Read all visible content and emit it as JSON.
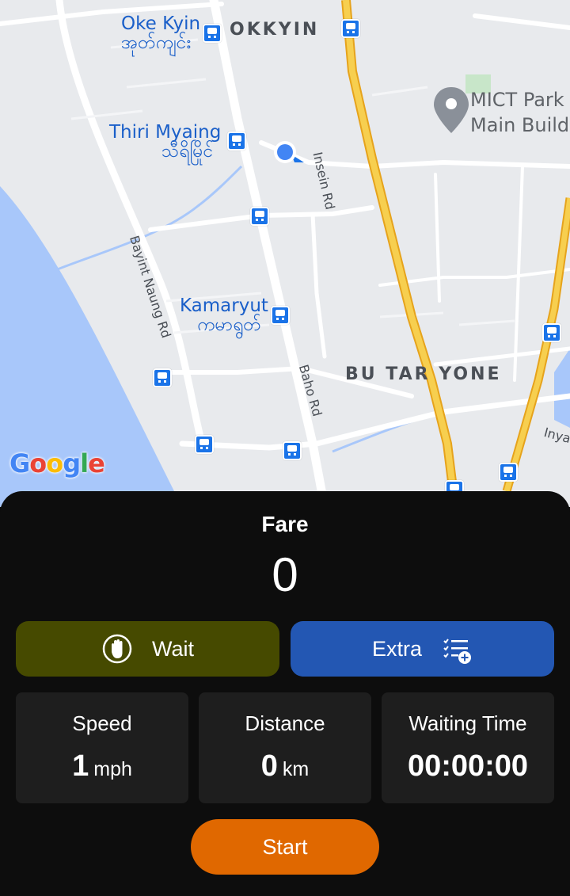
{
  "map": {
    "areas": {
      "okkyin": "OKKYIN",
      "bu_tar_yone": "BU TAR YONE"
    },
    "places": {
      "oke_kyin_en": "Oke Kyin",
      "oke_kyin_my": "အုတ်ကျင်း",
      "thiri_myaing_en": "Thiri Myaing",
      "thiri_myaing_my": "သီရိမြိုင်",
      "kamaryut_en": "Kamaryut",
      "kamaryut_my": "ကမာရွတ်"
    },
    "poi": {
      "line1": "MICT Park",
      "line2": "Main Build"
    },
    "roads": {
      "insein": "Insein Rd",
      "bayint_naung": "Bayint Naung Rd",
      "baho": "Baho Rd",
      "inya": "Inya"
    },
    "logo": "Google",
    "colors": {
      "background": "#e8eaed",
      "river": "#a8c7fa",
      "highway": "#f5c242",
      "location": "#4285f4"
    }
  },
  "panel": {
    "fare_title": "Fare",
    "fare_value": "0",
    "wait_label": "Wait",
    "wait_icon": "hand-stop-icon",
    "extra_label": "Extra",
    "extra_icon": "checklist-add-icon",
    "stats": {
      "speed_label": "Speed",
      "speed_value": "1",
      "speed_unit": "mph",
      "distance_label": "Distance",
      "distance_value": "0",
      "distance_unit": "km",
      "waiting_label": "Waiting Time",
      "waiting_value": "00:00:00"
    },
    "start_label": "Start",
    "colors": {
      "wait": "#464a00",
      "extra": "#2357b3",
      "start": "#e06800",
      "card": "#1e1e1e"
    }
  }
}
